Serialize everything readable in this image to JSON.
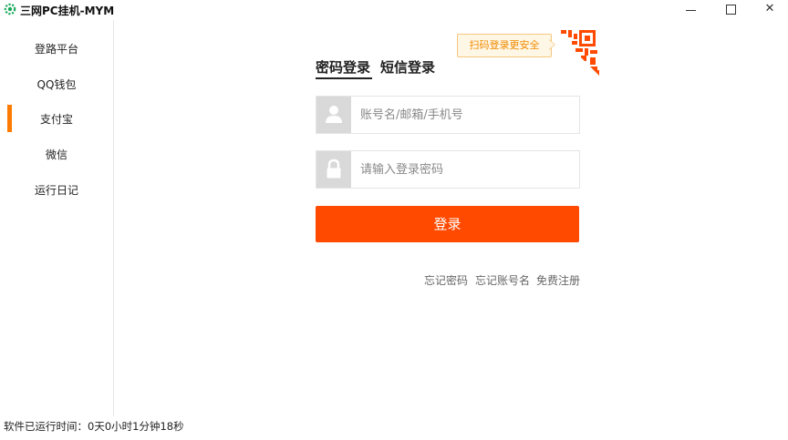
{
  "app": {
    "title": "三网PC挂机-MYM",
    "icon": "gear-icon",
    "icon_color": "#1aa85a"
  },
  "window_controls": {
    "minimize": "minimize-icon",
    "maximize": "maximize-icon",
    "close": "close-icon",
    "close_glyph": "✕"
  },
  "sidebar": {
    "accent_color": "#ff7a00",
    "active_index": 2,
    "items": [
      {
        "label": "登路平台"
      },
      {
        "label": "QQ钱包"
      },
      {
        "label": "支付宝"
      },
      {
        "label": "微信"
      },
      {
        "label": "运行日记"
      }
    ]
  },
  "login": {
    "tabs": [
      {
        "label": "密码登录",
        "active": true
      },
      {
        "label": "短信登录",
        "active": false
      }
    ],
    "qr_tip": "扫码登录更安全",
    "qr_icon": "qr-code-icon",
    "qr_color": "#ff4a00",
    "username": {
      "placeholder": "账号名/邮箱/手机号",
      "value": "",
      "icon": "user-icon"
    },
    "password": {
      "placeholder": "请输入登录密码",
      "value": "",
      "icon": "lock-icon"
    },
    "submit_label": "登录",
    "submit_color": "#ff4a00",
    "links": {
      "forgot_password": "忘记密码",
      "forgot_account": "忘记账号名",
      "register": "免费注册"
    }
  },
  "status": {
    "runtime_text": "软件已运行时间：0天0小时1分钟18秒"
  }
}
